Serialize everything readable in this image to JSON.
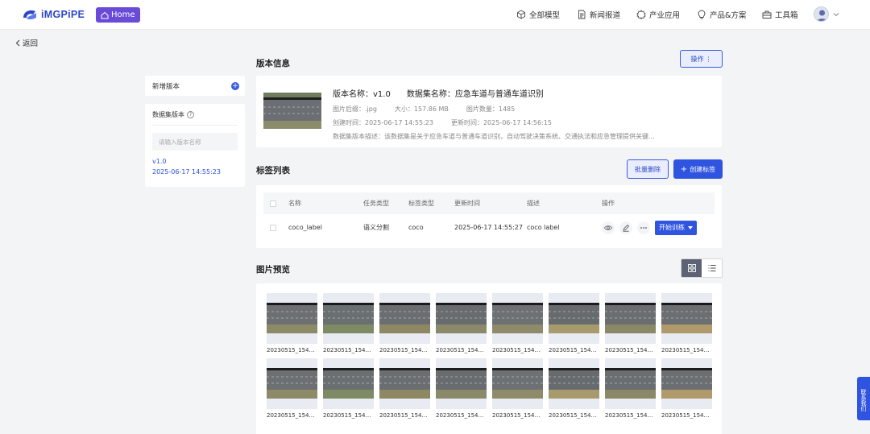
{
  "header": {
    "brand": "iMGPiPE",
    "home_label": "Home",
    "nav": [
      {
        "label": "全部模型",
        "icon": "cube-icon"
      },
      {
        "label": "新闻报道",
        "icon": "document-icon"
      },
      {
        "label": "产业应用",
        "icon": "gear-icon"
      },
      {
        "label": "产品&方案",
        "icon": "lightbulb-icon"
      },
      {
        "label": "工具箱",
        "icon": "toolbox-icon"
      }
    ]
  },
  "back_label": "返回",
  "sidebar": {
    "new_version_label": "新增版本",
    "dataset_versions_title": "数据集版本",
    "search_placeholder": "请输入版本名称",
    "versions": [
      {
        "name": "v1.0",
        "time": "2025-06-17 14:55:23"
      }
    ]
  },
  "version_info": {
    "section_title": "版本信息",
    "actions_button": "操作",
    "version_name_label": "版本名称：v1.0",
    "dataset_name_label": "数据集名称：应急车道与普通车道识别",
    "image_suffix": "图片后缀：.jpg",
    "size": "大小：157.86 MB",
    "image_count": "图片数量：1485",
    "created_time": "创建时间：2025-06-17 14:55:23",
    "updated_time": "更新时间：2025-06-17 14:56:15",
    "description": "数据集版本描述：该数据集是关于应急车道与普通车道识别，自动驾驶决策系统、交通执法和应急管理提供关键…"
  },
  "tags": {
    "section_title": "标签列表",
    "batch_delete": "批量删除",
    "create_tag": "创建标签",
    "columns": [
      "名称",
      "任务类型",
      "标签类型",
      "更新时间",
      "描述",
      "操作"
    ],
    "rows": [
      {
        "name": "coco_label",
        "task_type": "语义分割",
        "label_type": "coco",
        "updated": "2025-06-17 14:55:27",
        "desc": "coco label",
        "train_button": "开始训练"
      }
    ]
  },
  "preview": {
    "section_title": "图片预览",
    "images": [
      "20230515_15433…",
      "20230515_15433…",
      "20230515_15433…",
      "20230515_15433…",
      "20230515_15433…",
      "20230515_15433…",
      "20230515_15433…",
      "20230515_15433…",
      "20230515_15433…",
      "20230515_15433…",
      "20230515_15433…",
      "20230515_15433…",
      "20230515_15433…",
      "20230515_15433…",
      "20230515_15433…",
      "20230515_15433…"
    ]
  },
  "contact_label": "联系我们",
  "colors": {
    "primary": "#2f54e0",
    "home_badge": "#6a4bd8",
    "brand_text": "#2b47c8"
  }
}
